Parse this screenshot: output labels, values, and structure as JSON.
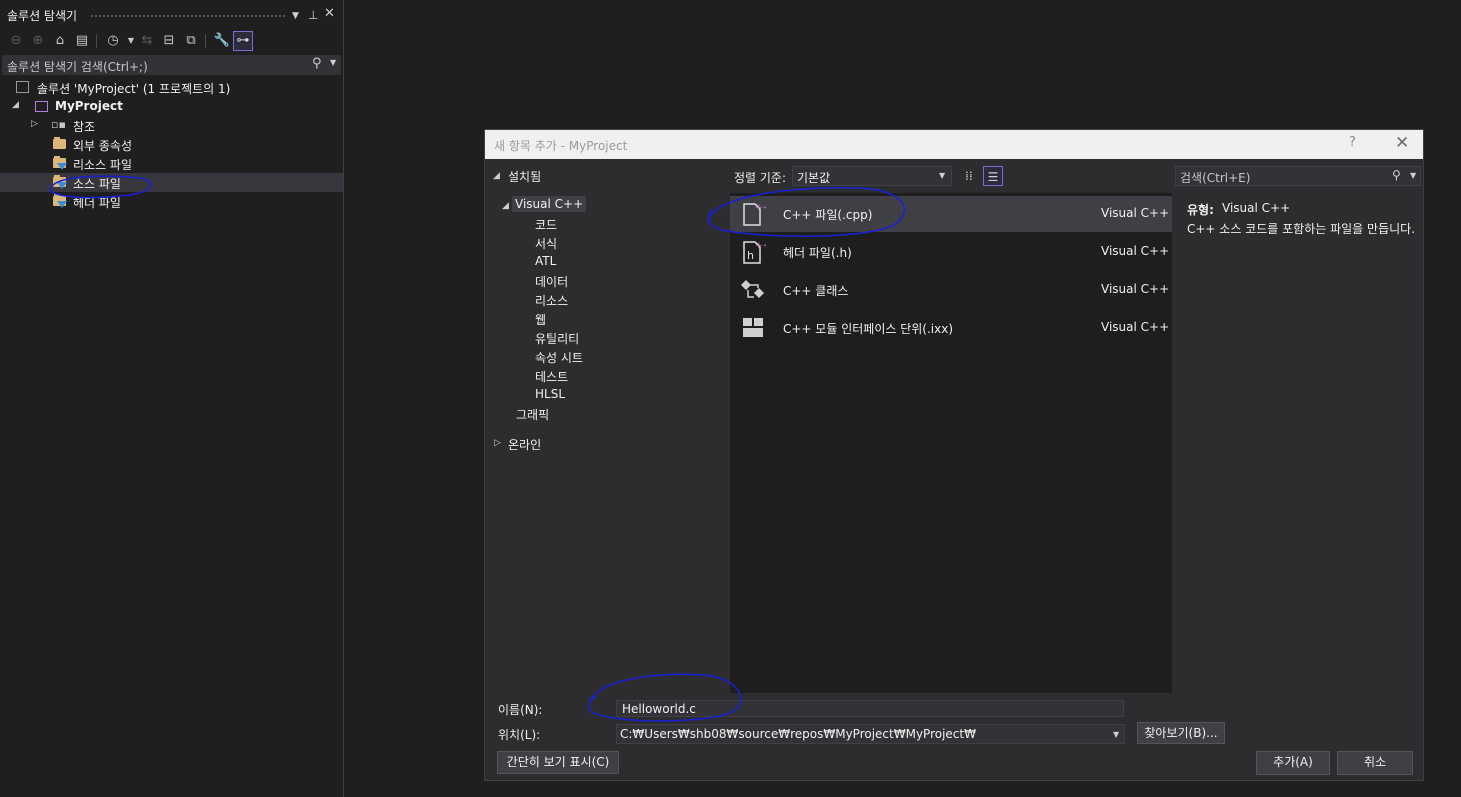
{
  "solution_explorer": {
    "title": "솔루션 탐색기",
    "search_placeholder": "솔루션 탐색기 검색(Ctrl+;)",
    "tree": {
      "solution": "솔루션 'MyProject' (1 프로젝트의 1)",
      "project": "MyProject",
      "references": "참조",
      "external_deps": "외부 종속성",
      "resource_files": "리소스 파일",
      "source_files": "소스 파일",
      "header_files": "헤더 파일"
    }
  },
  "dialog": {
    "title": "새 항목 추가 - MyProject",
    "help": "?",
    "close": "✕",
    "tree": {
      "installed": "설치됨",
      "visual_cpp": "Visual C++",
      "children": [
        "코드",
        "서식",
        "ATL",
        "데이터",
        "리소스",
        "웹",
        "유틸리티",
        "속성 시트",
        "테스트",
        "HLSL"
      ],
      "graphics": "그래픽",
      "online": "온라인"
    },
    "sort": {
      "label": "정렬 기준:",
      "value": "기본값"
    },
    "templates": [
      {
        "name": "C++ 파일(.cpp)",
        "lang": "Visual C++",
        "selected": true
      },
      {
        "name": "헤더 파일(.h)",
        "lang": "Visual C++",
        "selected": false
      },
      {
        "name": "C++ 클래스",
        "lang": "Visual C++",
        "selected": false
      },
      {
        "name": "C++ 모듈 인터페이스 단위(.ixx)",
        "lang": "Visual C++",
        "selected": false
      }
    ],
    "details": {
      "search_placeholder": "검색(Ctrl+E)",
      "type_label": "유형:",
      "type_value": "Visual C++",
      "description": "C++ 소스 코드를 포함하는 파일을 만듭니다."
    },
    "form": {
      "name_label": "이름(N):",
      "name_value": "Helloworld.c",
      "location_label": "위치(L):",
      "location_value": "C:₩Users₩shb08₩source₩repos₩MyProject₩MyProject₩",
      "browse_button": "찾아보기(B)...",
      "compact_view_button": "간단히 보기 표시(C)",
      "add_button": "추가(A)",
      "cancel_button": "취소"
    }
  },
  "colors": {
    "background": "#1f1f1f",
    "dialog_bg": "#2d2d30",
    "list_bg": "#1e1e1e",
    "accent": "#7b6bd6",
    "annotation": "#1a1fd6"
  }
}
